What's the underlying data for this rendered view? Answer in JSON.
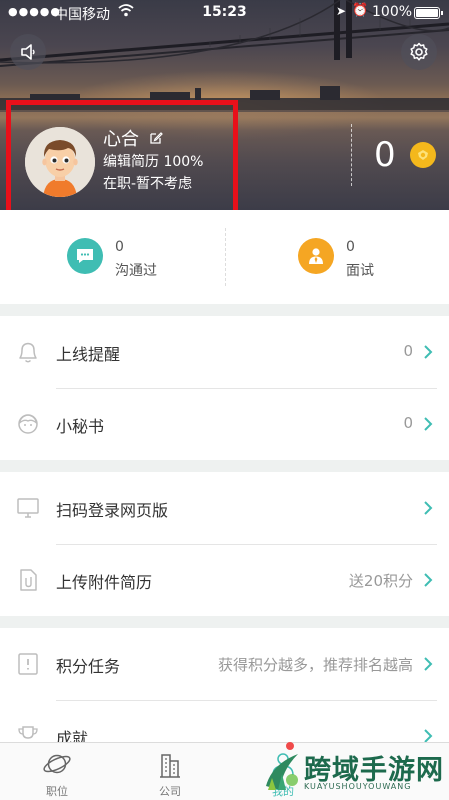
{
  "status_bar": {
    "signal": "●●●●●",
    "carrier": "中国移动",
    "time": "15:23",
    "battery": "100%"
  },
  "profile": {
    "name": "心合",
    "resume_completion": "编辑简历 100%",
    "job_status": "在职-暂不考虑"
  },
  "coins": {
    "count": "0",
    "color": "#f4b81c"
  },
  "stats": [
    {
      "count": "0",
      "label": "沟通过",
      "icon": "chat-icon",
      "color": "#3fbdb3"
    },
    {
      "count": "0",
      "label": "面试",
      "icon": "interview-icon",
      "color": "#f5a623"
    }
  ],
  "menu_group_1": [
    {
      "label": "上线提醒",
      "value": "0",
      "icon": "bell-icon"
    },
    {
      "label": "小秘书",
      "value": "0",
      "icon": "assistant-icon"
    }
  ],
  "menu_group_2": [
    {
      "label": "扫码登录网页版",
      "value": "",
      "icon": "monitor-icon"
    },
    {
      "label": "上传附件简历",
      "value": "送20积分",
      "icon": "attachment-icon"
    }
  ],
  "menu_group_3": [
    {
      "label": "积分任务",
      "value": "获得积分越多，推荐排名越高",
      "icon": "task-icon"
    },
    {
      "label": "成就",
      "value": "",
      "icon": "trophy-icon"
    }
  ],
  "tabbar": [
    {
      "label": "职位",
      "icon": "planet-icon"
    },
    {
      "label": "公司",
      "icon": "building-icon"
    },
    {
      "label": "我的",
      "icon": "profile-icon"
    }
  ],
  "watermark": {
    "title": "跨域手游网",
    "subtitle": "KUAYUSHOUYOUWANG"
  },
  "accent_color": "#3fbdb3",
  "highlight_color": "#e8101a"
}
